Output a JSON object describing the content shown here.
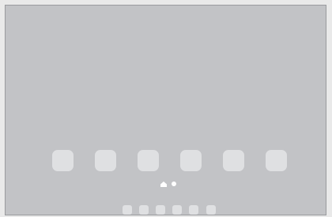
{
  "screen": {
    "background_color": "#c2c3c6",
    "tile_color": "#dfe0e2",
    "indicator_color": "#ffffff"
  },
  "home_screen": {
    "app_slots": [
      {
        "icon": "app-placeholder-icon"
      },
      {
        "icon": "app-placeholder-icon"
      },
      {
        "icon": "app-placeholder-icon"
      },
      {
        "icon": "app-placeholder-icon"
      },
      {
        "icon": "app-placeholder-icon"
      },
      {
        "icon": "app-placeholder-icon"
      }
    ],
    "page_indicator": {
      "home_icon": "home-icon",
      "pages": 1,
      "current_page": 1
    }
  },
  "dock": {
    "slots": [
      {
        "icon": "app-placeholder-icon"
      },
      {
        "icon": "app-placeholder-icon"
      },
      {
        "icon": "app-placeholder-icon"
      },
      {
        "icon": "app-placeholder-icon"
      },
      {
        "icon": "app-placeholder-icon"
      },
      {
        "icon": "app-placeholder-icon"
      }
    ]
  }
}
